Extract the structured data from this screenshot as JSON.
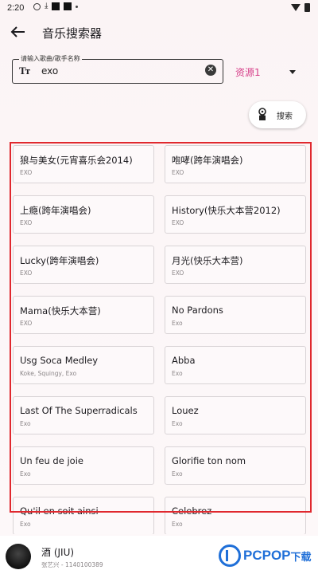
{
  "status_bar": {
    "time": "2:20"
  },
  "app_bar": {
    "title": "音乐搜索器"
  },
  "search": {
    "label": "请输入歌曲/歌手名称",
    "value": "exo",
    "type_icon": "Tт"
  },
  "source_select": {
    "value": "资源1"
  },
  "search_button": {
    "label": "搜索"
  },
  "results": [
    {
      "title": "狼与美女(元宵喜乐会2014)",
      "artist": "EXO"
    },
    {
      "title": "咆哮(跨年演唱会)",
      "artist": "EXO"
    },
    {
      "title": "上瘾(跨年演唱会)",
      "artist": "EXO"
    },
    {
      "title": "History(快乐大本营2012)",
      "artist": "EXO"
    },
    {
      "title": "Lucky(跨年演唱会)",
      "artist": "EXO"
    },
    {
      "title": "月光(快乐大本营)",
      "artist": "EXO"
    },
    {
      "title": "Mama(快乐大本营)",
      "artist": "EXO"
    },
    {
      "title": "No Pardons",
      "artist": "Exo"
    },
    {
      "title": "Usg Soca Medley",
      "artist": "Koke, Squingy, Exo"
    },
    {
      "title": "Abba",
      "artist": "Exo"
    },
    {
      "title": "Last Of The Superradicals",
      "artist": "Exo"
    },
    {
      "title": "Louez",
      "artist": "Exo"
    },
    {
      "title": "Un feu de joie",
      "artist": "Exo"
    },
    {
      "title": "Glorifie ton nom",
      "artist": "Exo"
    },
    {
      "title": "Qu'il en soit ainsi",
      "artist": "Exo"
    },
    {
      "title": "Celebrez",
      "artist": "Exo"
    }
  ],
  "player": {
    "title": "酒 (JIU)",
    "subtitle": "张艺兴 - 1140100389"
  },
  "watermark": {
    "text": "PCPOP",
    "text_cn": "下载"
  },
  "colors": {
    "accent": "#d6408a",
    "highlight": "#e0282e",
    "watermark": "#1f6fd8"
  }
}
